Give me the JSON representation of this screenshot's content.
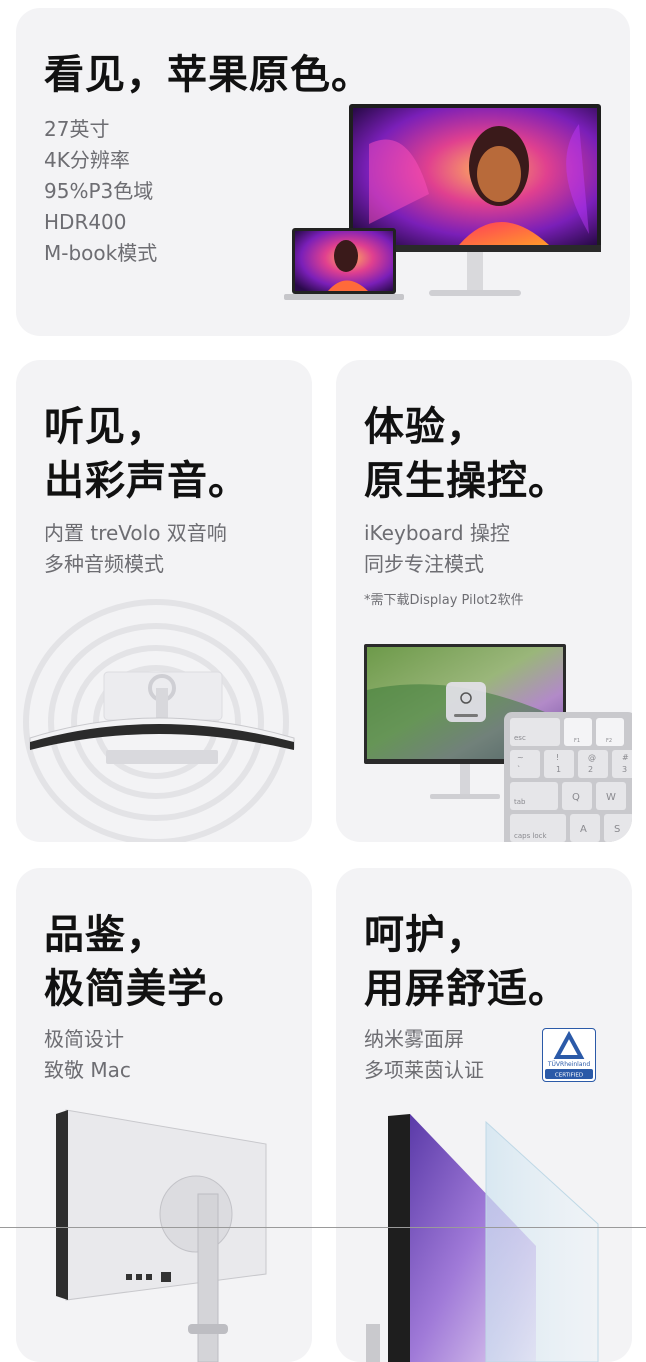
{
  "cards": {
    "display": {
      "title": "看见，苹果原色。",
      "features": [
        "27英寸",
        "4K分辨率",
        "95%P3色域",
        "HDR400",
        "M-book模式"
      ]
    },
    "audio": {
      "title_line1": "听见，",
      "title_line2": "出彩声音。",
      "features": [
        "内置 treVolo 双音响",
        "多种音频模式"
      ]
    },
    "control": {
      "title_line1": "体验，",
      "title_line2": "原生操控。",
      "features": [
        "iKeyboard 操控",
        "同步专注模式"
      ],
      "note": "*需下载Display Pilot2软件",
      "keyboard_keys": {
        "esc": "esc",
        "f1": "F1",
        "f2": "F2",
        "tilde_top": "~",
        "tilde_bottom": "`",
        "excl_top": "!",
        "excl_bottom": "1",
        "at_top": "@",
        "at_bottom": "2",
        "hash_top": "#",
        "hash_bottom": "3",
        "tab": "tab",
        "q": "Q",
        "w": "W",
        "caps": "caps lock",
        "a": "A",
        "s": "S"
      }
    },
    "design": {
      "title_line1": "品鉴，",
      "title_line2": "极简美学。",
      "features": [
        "极简设计",
        "致敬 Mac"
      ]
    },
    "eyecare": {
      "title_line1": "呵护，",
      "title_line2": "用屏舒适。",
      "features": [
        "纳米雾面屏",
        "多项莱茵认证"
      ],
      "badge": {
        "brand": "TÜVRheinland",
        "label": "CERTIFIED"
      }
    }
  },
  "colors": {
    "card_bg": "#f3f3f5",
    "text_primary": "#111111",
    "text_secondary": "#6d6d72",
    "tuv_blue": "#2b5aa8"
  }
}
